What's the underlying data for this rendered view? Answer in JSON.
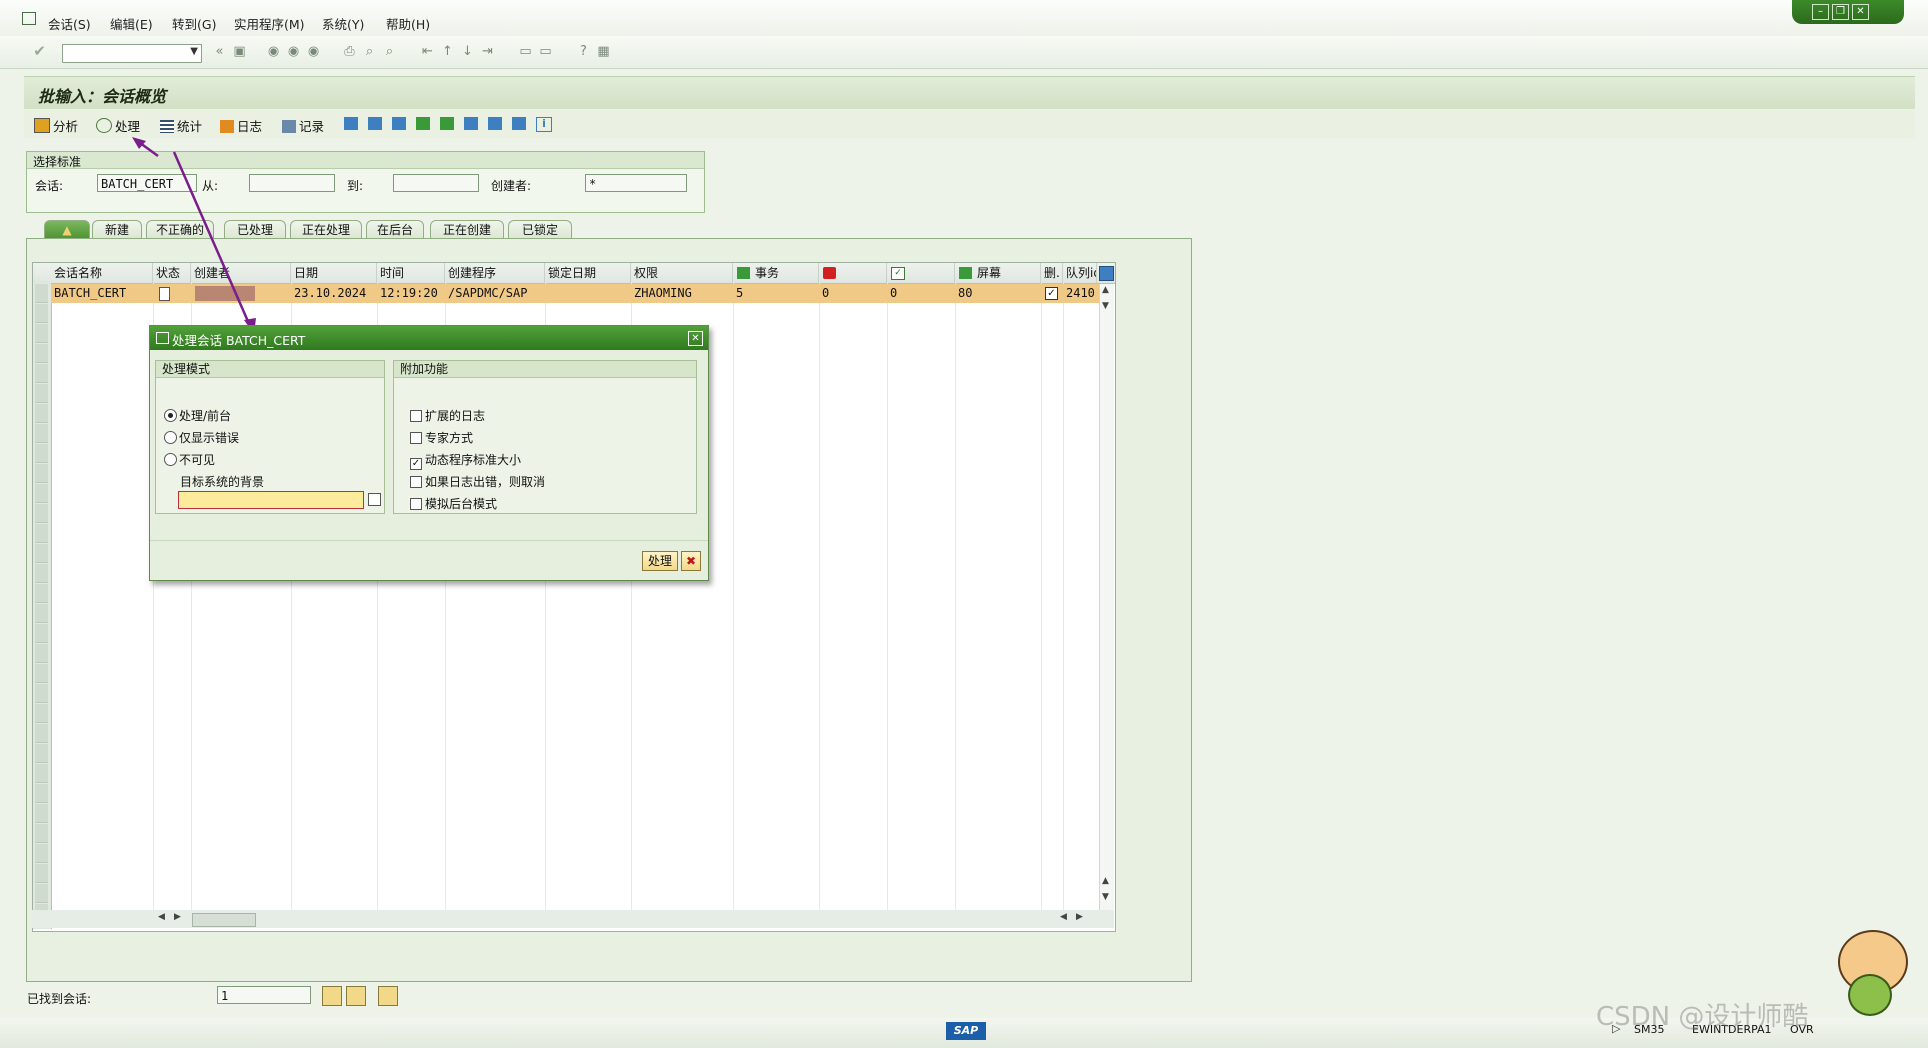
{
  "menu": [
    "会话(S)",
    "编辑(E)",
    "转到(G)",
    "实用程序(M)",
    "系统(Y)",
    "帮助(H)"
  ],
  "page_title": "批输入：会话概览",
  "app_toolbar": {
    "analyze": "分析",
    "process": "处理",
    "stats": "统计",
    "log": "日志",
    "record": "记录"
  },
  "selection": {
    "heading": "选择标准",
    "session_label": "会话:",
    "session_value": "BATCH_CERT",
    "from_label": "从:",
    "to_label": "到:",
    "creator_label": "创建者:",
    "creator_value": "*"
  },
  "tabs": [
    "新建",
    "不正确的",
    "已处理",
    "正在处理",
    "在后台",
    "正在创建",
    "已锁定"
  ],
  "table": {
    "headers": [
      "会话名称",
      "状态",
      "创建者",
      "日期",
      "时间",
      "创建程序",
      "锁定日期",
      "权限",
      "事务",
      "",
      "",
      "屏幕",
      "删.",
      "队列id"
    ],
    "row": {
      "name": "BATCH_CERT",
      "creator": "",
      "date": "23.10.2024",
      "time": "12:19:20",
      "program": "/SAPDMC/SAP",
      "lock_date": "",
      "auth": "ZHAOMING",
      "transactions": "5",
      "errors": "0",
      "processed": "0",
      "screens": "80",
      "queue": "2410"
    }
  },
  "dialog": {
    "title": "处理会话 BATCH_CERT",
    "mode_heading": "处理模式",
    "mode_options": [
      "处理/前台",
      "仅显示错误",
      "不可见"
    ],
    "target_label": "目标系统的背景",
    "target_value": "",
    "extra_heading": "附加功能",
    "extra_options": [
      "扩展的日志",
      "专家方式",
      "动态程序标准大小",
      "如果日志出错，则取消",
      "模拟后台模式"
    ],
    "process_button": "处理"
  },
  "footer": {
    "found_label": "已找到会话:",
    "found_value": "1"
  },
  "status": {
    "tcode": "SM35",
    "server": "EWINTDERPA1",
    "mode": "OVR"
  },
  "watermark": "CSDN @设计师酷",
  "colors": {
    "accent_green": "#3a8a26",
    "row_highlight": "#f1c987",
    "arrow": "#7a1e8c"
  }
}
